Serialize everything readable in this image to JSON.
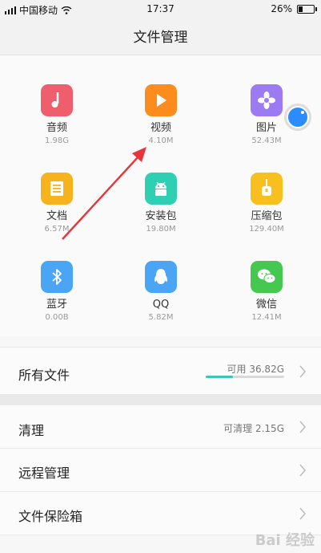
{
  "status_bar": {
    "carrier": "中国移动",
    "time": "17:37",
    "battery_percent": "26%",
    "battery_level": 0.26
  },
  "header": {
    "title": "文件管理"
  },
  "categories": [
    {
      "label": "音频",
      "size": "1.98G",
      "icon": "music-note-icon",
      "color": "#ef5e6d"
    },
    {
      "label": "视频",
      "size": "4.10M",
      "icon": "play-icon",
      "color": "#fb8c1d"
    },
    {
      "label": "图片",
      "size": "52.43M",
      "icon": "flower-icon",
      "color": "#9b7af2"
    },
    {
      "label": "文档",
      "size": "6.57M",
      "icon": "document-icon",
      "color": "#f6b31e"
    },
    {
      "label": "安装包",
      "size": "19.80M",
      "icon": "android-icon",
      "color": "#2fcfb4"
    },
    {
      "label": "压缩包",
      "size": "129.40M",
      "icon": "archive-icon",
      "color": "#f8c01f"
    },
    {
      "label": "蓝牙",
      "size": "0.00B",
      "icon": "bluetooth-icon",
      "color": "#4aa6f5"
    },
    {
      "label": "QQ",
      "size": "5.82M",
      "icon": "qq-penguin-icon",
      "color": "#4aa6f5"
    },
    {
      "label": "微信",
      "size": "12.41M",
      "icon": "wechat-icon",
      "color": "#45c84f"
    }
  ],
  "all_files": {
    "label": "所有文件",
    "available": "可用 36.82G",
    "used_fraction": 0.35
  },
  "clean": {
    "label": "清理",
    "info": "可清理 2.15G"
  },
  "remote": {
    "label": "远程管理"
  },
  "vault": {
    "label": "文件保险箱"
  },
  "watermark": "Bai 经验",
  "colors": {
    "accent": "#3cc6b5",
    "arrow": "#e8353b"
  }
}
